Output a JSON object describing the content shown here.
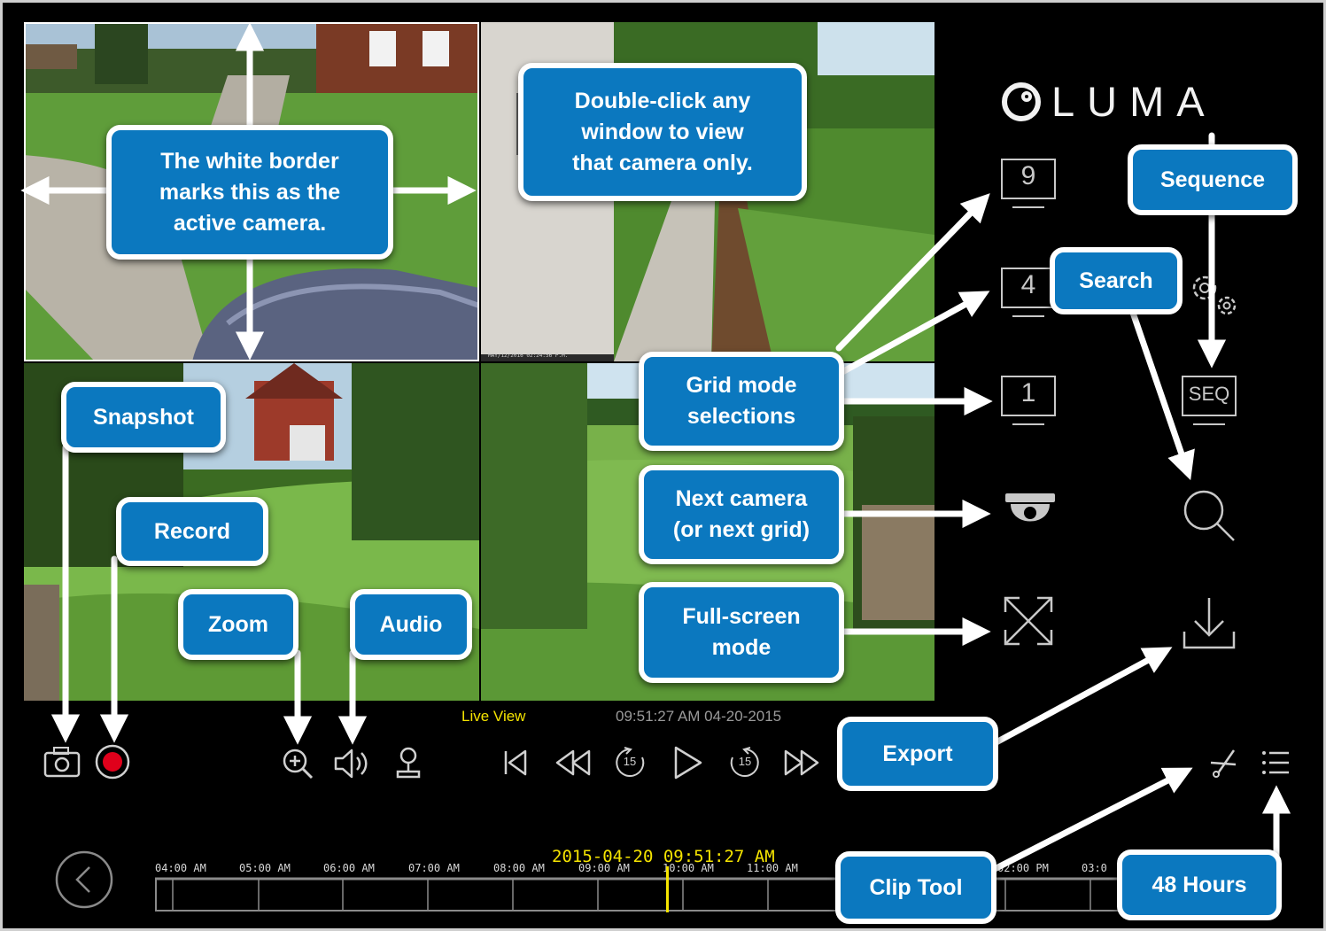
{
  "brand": {
    "name": "LUMA"
  },
  "status": {
    "mode": "Live View",
    "clock": "09:51:27 AM 04-20-2015"
  },
  "cameras": {
    "cam2_timestamp": "MAY/12/2016 02:24:56 P.M."
  },
  "grid_buttons": [
    "9",
    "4",
    "1"
  ],
  "sequence_label": "SEQ",
  "timeline": {
    "current": "2015-04-20 09:51:27 AM",
    "ticks": [
      "04:00 AM",
      "05:00 AM",
      "06:00 AM",
      "07:00 AM",
      "08:00 AM",
      "09:00 AM",
      "10:00 AM",
      "11:00 AM",
      "02:00 PM",
      "03:0"
    ]
  },
  "rewind_seconds": "15",
  "forward_seconds": "15",
  "callouts": {
    "active_camera": "The white border\nmarks this as the\nactive camera.",
    "double_click": "Double-click any\nwindow to view\nthat camera only.",
    "sequence": "Sequence",
    "search": "Search",
    "grid_mode": "Grid mode\nselections",
    "next_camera": "Next camera\n(or next grid)",
    "full_screen": "Full-screen\nmode",
    "snapshot": "Snapshot",
    "record": "Record",
    "zoom": "Zoom",
    "audio": "Audio",
    "export": "Export",
    "clip_tool": "Clip Tool",
    "hours_48": "48 Hours"
  },
  "colors": {
    "callout_fill": "#0b78bf",
    "status_yellow": "#f5e400",
    "record_red": "#e0001b",
    "icon_gray": "#c8c8c8"
  }
}
